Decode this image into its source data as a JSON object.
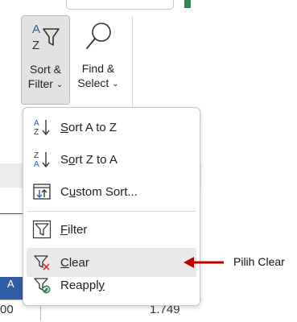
{
  "ribbon": {
    "sort_filter": {
      "line1": "Sort &",
      "line2": "Filter"
    },
    "find_select": {
      "line1": "Find &",
      "line2": "Select"
    }
  },
  "menu": {
    "items": [
      {
        "pre": "",
        "key": "S",
        "post": "ort A to Z",
        "icon": "sort-ascending-icon"
      },
      {
        "pre": "S",
        "key": "o",
        "post": "rt Z to A",
        "icon": "sort-descending-icon"
      },
      {
        "pre": "C",
        "key": "u",
        "post": "stom Sort...",
        "icon": "custom-sort-icon"
      },
      {
        "pre": "",
        "key": "F",
        "post": "ilter",
        "icon": "filter-icon"
      },
      {
        "pre": "",
        "key": "C",
        "post": "lear",
        "icon": "clear-filter-icon"
      },
      {
        "pre": "Reappl",
        "key": "y",
        "post": "",
        "icon": "reapply-filter-icon"
      }
    ]
  },
  "annotation": {
    "text": "Pilih Clear",
    "color": "#c00000"
  },
  "sheet": {
    "column_letter": "A",
    "cell_left": "00",
    "cell_right": "1.749"
  },
  "colors": {
    "accent": "#2e5ea6",
    "filter_green": "#2e8b57",
    "clear_red": "#d13438"
  }
}
